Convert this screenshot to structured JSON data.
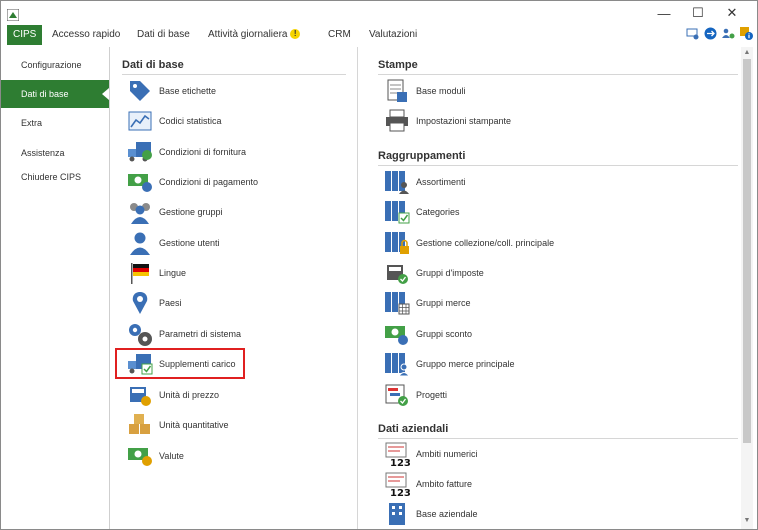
{
  "menubar": {
    "tabs": [
      {
        "label": "CIPS"
      },
      {
        "label": "Accesso rapido"
      },
      {
        "label": "Dati di base"
      },
      {
        "label": "Attività giornaliera"
      },
      {
        "label": "CRM"
      },
      {
        "label": "Valutazioni"
      }
    ],
    "notification_badge": "!"
  },
  "window_controls": {
    "minimize": "—",
    "maximize": "☐",
    "close": "✕"
  },
  "sidebar": {
    "items": [
      {
        "label": "Configurazione"
      },
      {
        "label": "Dati di base"
      },
      {
        "label": "Extra"
      },
      {
        "label": "Assistenza"
      },
      {
        "label": "Chiudere CIPS"
      }
    ]
  },
  "left_section": {
    "title": "Dati di base",
    "items": [
      {
        "label": "Base etichette",
        "icon": "tag-icon"
      },
      {
        "label": "Codici statistica",
        "icon": "chart-icon"
      },
      {
        "label": "Condizioni di fornitura",
        "icon": "truck-icon"
      },
      {
        "label": "Condizioni di pagamento",
        "icon": "money-icon"
      },
      {
        "label": "Gestione gruppi",
        "icon": "users-icon"
      },
      {
        "label": "Gestione utenti",
        "icon": "user-icon"
      },
      {
        "label": "Lingue",
        "icon": "flag-icon"
      },
      {
        "label": "Paesi",
        "icon": "map-pin-icon"
      },
      {
        "label": "Parametri di sistema",
        "icon": "gears-icon"
      },
      {
        "label": "Supplementi carico",
        "icon": "truck-check-icon"
      },
      {
        "label": "Unità di prezzo",
        "icon": "register-icon"
      },
      {
        "label": "Unità quantitative",
        "icon": "boxes-icon"
      },
      {
        "label": "Valute",
        "icon": "currency-icon"
      }
    ]
  },
  "right_section": {
    "stampe": {
      "title": "Stampe",
      "items": [
        {
          "label": "Base moduli",
          "icon": "form-icon"
        },
        {
          "label": "Impostazioni stampante",
          "icon": "printer-icon"
        }
      ]
    },
    "raggruppamenti": {
      "title": "Raggruppamenti",
      "items": [
        {
          "label": "Assortimenti",
          "icon": "binders-user-icon"
        },
        {
          "label": "Categories",
          "icon": "binders-check-icon"
        },
        {
          "label": "Gestione collezione/coll. principale",
          "icon": "binders-lock-icon"
        },
        {
          "label": "Gruppi d'imposte",
          "icon": "register-check-icon"
        },
        {
          "label": "Gruppi merce",
          "icon": "binders-table-icon"
        },
        {
          "label": "Gruppi sconto",
          "icon": "discount-icon"
        },
        {
          "label": "Gruppo merce principale",
          "icon": "binders-user2-icon"
        },
        {
          "label": "Progetti",
          "icon": "project-icon"
        }
      ]
    },
    "dati_aziendali": {
      "title": "Dati aziendali",
      "items": [
        {
          "label": "Ambiti numerici",
          "icon": "number-doc-icon",
          "badge": "123"
        },
        {
          "label": "Ambito fatture",
          "icon": "invoice-number-icon",
          "badge": "123"
        },
        {
          "label": "Base aziendale",
          "icon": "building-icon"
        }
      ]
    }
  },
  "colors": {
    "accent": "#2e7d32",
    "highlight": "#e02020",
    "icon_blue": "#3a6fb5",
    "icon_green": "#43a047"
  }
}
